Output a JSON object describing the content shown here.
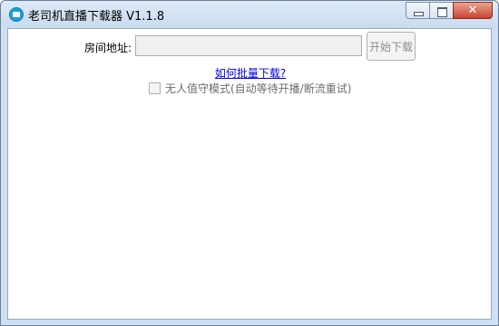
{
  "window": {
    "title": "老司机直播下载器 V1.1.8",
    "close_glyph": "✕"
  },
  "form": {
    "room_label": "房间地址:",
    "room_input": {
      "value": "",
      "placeholder": ""
    },
    "start_button": "开始下载",
    "batch_link": "如何批量下载?",
    "unattended_checkbox": {
      "label": "无人值守模式(自动等待开播/断流重试)",
      "checked": false
    }
  }
}
